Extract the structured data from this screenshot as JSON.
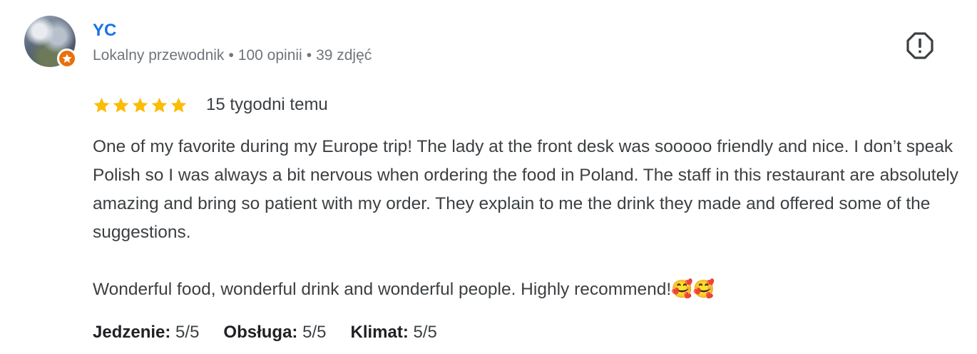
{
  "author": {
    "name": "YC",
    "meta": {
      "role": "Lokalny przewodnik",
      "reviews": "100 opinii",
      "photos": "39 zdjęć"
    },
    "badge_color": "#e8710a"
  },
  "review": {
    "rating": 5,
    "rating_max": 5,
    "date": "15 tygodni temu",
    "paragraphs": [
      "One of my favorite during my Europe trip! The lady at the front desk was sooooo friendly and nice. I don’t speak Polish so I was always a bit nervous when ordering the food in Poland. The staff in this restaurant are absolutely amazing and bring so patient with my order. They explain to me the drink they made and offered some of the suggestions.",
      "Wonderful food, wonderful drink and wonderful people. Highly recommend!🥰🥰"
    ],
    "sub_ratings": [
      {
        "label": "Jedzenie:",
        "value": "5/5"
      },
      {
        "label": "Obsługa:",
        "value": "5/5"
      },
      {
        "label": "Klimat:",
        "value": "5/5"
      }
    ]
  },
  "colors": {
    "star": "#fbbc04",
    "name_link": "#1a73e8",
    "meta_text": "#70757a",
    "body_text": "#3c4043"
  },
  "icons": {
    "report": "report-flag-icon",
    "badge": "local-guide-star-icon",
    "star": "star-icon"
  }
}
